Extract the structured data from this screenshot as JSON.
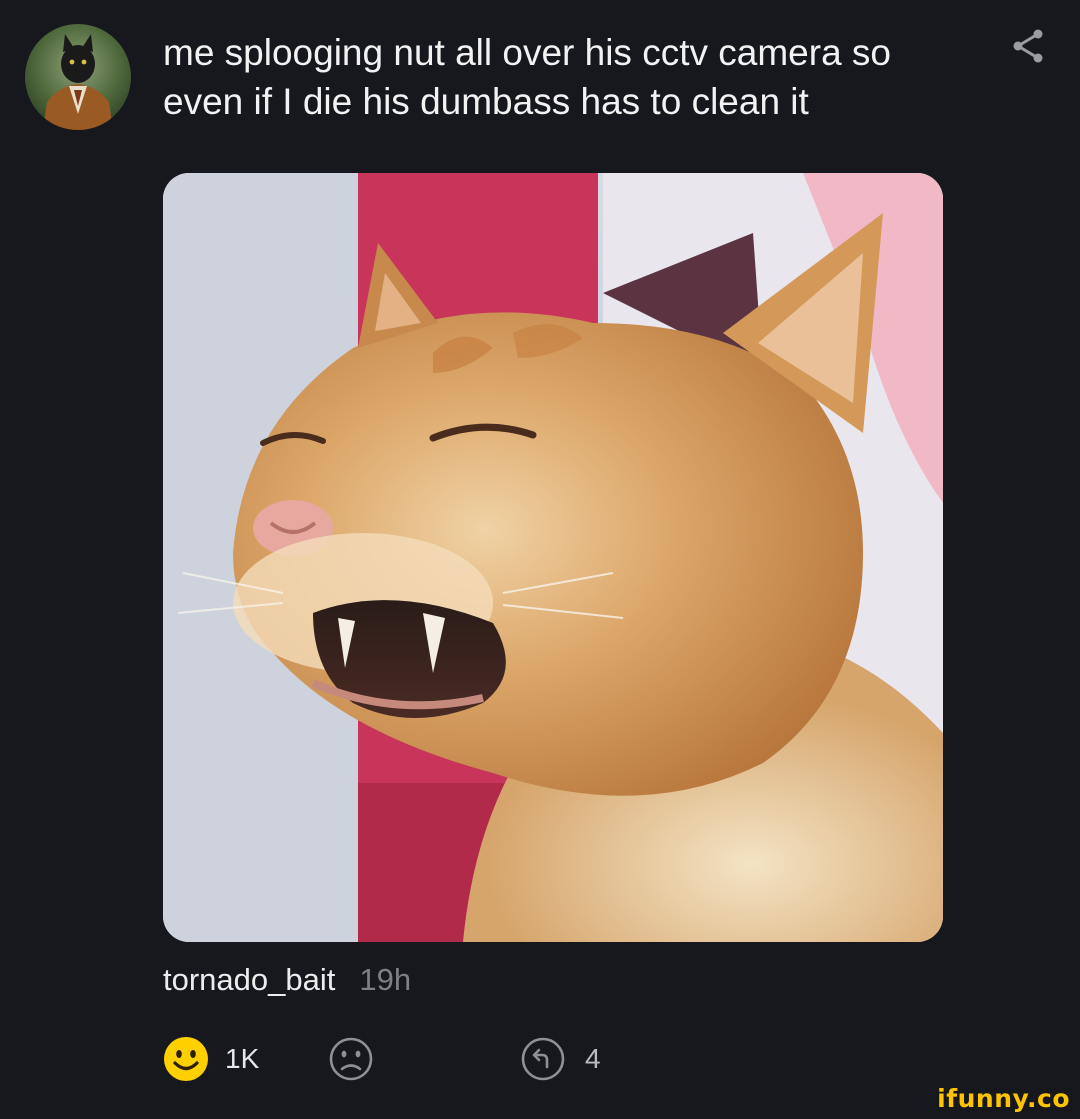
{
  "post": {
    "comment_text": "me splooging nut all over his cctv camera so even if I die his dumbass has to clean it",
    "image_description": "",
    "username": "tornado_bait",
    "time_ago": "19h",
    "smile_count": "1K",
    "replies_count": "4"
  },
  "icons": {
    "avatar": "avatar-cat-in-suit",
    "share": "share-icon",
    "smile": "smile-icon",
    "unsmile": "unsmile-icon",
    "reply": "reply-icon"
  },
  "colors": {
    "background": "#17181d",
    "smile_yellow": "#ffd000",
    "muted_gray": "#7d7f86",
    "watermark": "#ffc400"
  },
  "watermark": {
    "text": "ifunny.co"
  }
}
